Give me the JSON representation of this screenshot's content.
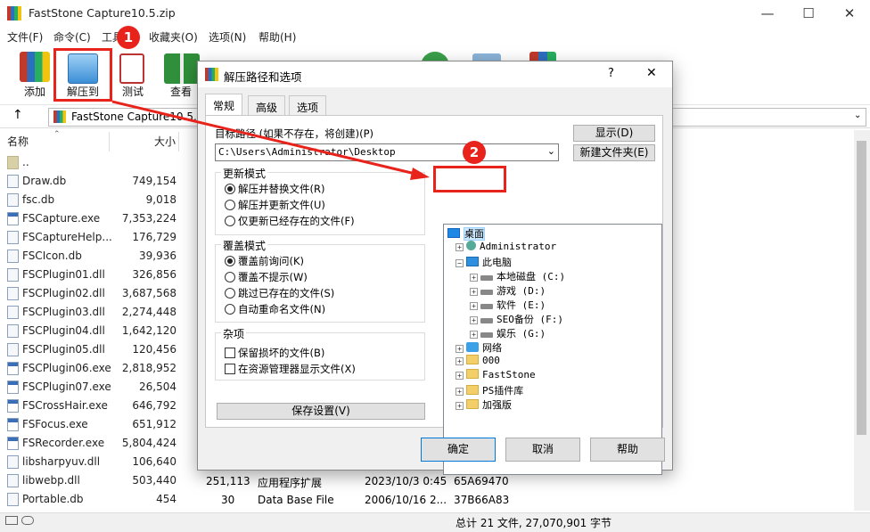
{
  "window": {
    "title": "FastStone Capture10.5.zip",
    "minimize": "—",
    "maximize": "☐",
    "close": "✕"
  },
  "menu": [
    "文件(F)",
    "命令(C)",
    "工具",
    "收藏夹(O)",
    "选项(N)",
    "帮助(H)"
  ],
  "toolbar": [
    {
      "label": "添加",
      "icon": "add-archive-icon"
    },
    {
      "label": "解压到",
      "icon": "extract-to-icon"
    },
    {
      "label": "测试",
      "icon": "test-icon"
    },
    {
      "label": "查看",
      "icon": "view-book-icon"
    }
  ],
  "address": {
    "up": "↑",
    "path": "FastStone Capture10.5.zi"
  },
  "list": {
    "headers": {
      "name": "名称",
      "size": "大小"
    },
    "rows": [
      {
        "name": "..",
        "size": "",
        "type": "folder"
      },
      {
        "name": "Draw.db",
        "size": "749,154",
        "type": "file"
      },
      {
        "name": "fsc.db",
        "size": "9,018",
        "type": "file"
      },
      {
        "name": "FSCapture.exe",
        "size": "7,353,224",
        "type": "exe"
      },
      {
        "name": "FSCaptureHelp...",
        "size": "176,729",
        "type": "help"
      },
      {
        "name": "FSCIcon.db",
        "size": "39,936",
        "type": "file"
      },
      {
        "name": "FSCPlugin01.dll",
        "size": "326,856",
        "type": "file"
      },
      {
        "name": "FSCPlugin02.dll",
        "size": "3,687,568",
        "type": "file"
      },
      {
        "name": "FSCPlugin03.dll",
        "size": "2,274,448",
        "type": "file"
      },
      {
        "name": "FSCPlugin04.dll",
        "size": "1,642,120",
        "type": "file"
      },
      {
        "name": "FSCPlugin05.dll",
        "size": "120,456",
        "type": "file"
      },
      {
        "name": "FSCPlugin06.exe",
        "size": "2,818,952",
        "type": "exe"
      },
      {
        "name": "FSCPlugin07.exe",
        "size": "26,504",
        "type": "exe"
      },
      {
        "name": "FSCrossHair.exe",
        "size": "646,792",
        "type": "exe"
      },
      {
        "name": "FSFocus.exe",
        "size": "651,912",
        "type": "exe"
      },
      {
        "name": "FSRecorder.exe",
        "size": "5,804,424",
        "type": "exe"
      },
      {
        "name": "libsharpyuv.dll",
        "size": "106,640",
        "type": "file"
      },
      {
        "name": "libwebp.dll",
        "size": "503,440",
        "type": "file"
      },
      {
        "name": "Portable.db",
        "size": "454",
        "type": "file"
      }
    ],
    "extra_rows": [
      {
        "packed": "251,113",
        "type": "应用程序扩展",
        "modified": "2023/10/3 0:45",
        "crc": "65A69470"
      },
      {
        "packed": "30",
        "type": "Data Base File",
        "modified": "2006/10/16 2...",
        "crc": "37B66A83"
      }
    ]
  },
  "status": {
    "text": "总计 21 文件, 27,070,901 字节"
  },
  "dialog": {
    "title": "解压路径和选项",
    "help": "?",
    "close": "✕",
    "tabs": [
      "常规",
      "高级",
      "选项"
    ],
    "dest_label": "目标路径 (如果不存在，将创建)(P)",
    "dest_value": "C:\\Users\\Administrator\\Desktop",
    "show_button": "显示(D)",
    "new_folder_button": "新建文件夹(E)",
    "update_mode": {
      "title": "更新模式",
      "options": [
        "解压并替换文件(R)",
        "解压并更新文件(U)",
        "仅更新已经存在的文件(F)"
      ],
      "selected": 0
    },
    "overwrite_mode": {
      "title": "覆盖模式",
      "options": [
        "覆盖前询问(K)",
        "覆盖不提示(W)",
        "跳过已存在的文件(S)",
        "自动重命名文件(N)"
      ],
      "selected": 0
    },
    "misc": {
      "title": "杂项",
      "options": [
        "保留损坏的文件(B)",
        "在资源管理器显示文件(X)"
      ]
    },
    "save_button": "保存设置(V)",
    "tree": [
      {
        "label": "桌面",
        "icon": "desk",
        "level": 0,
        "exp": ""
      },
      {
        "label": "Administrator",
        "icon": "user",
        "level": 1,
        "exp": "+"
      },
      {
        "label": "此电脑",
        "icon": "pc",
        "level": 1,
        "exp": "−"
      },
      {
        "label": "本地磁盘 (C:)",
        "icon": "drive",
        "level": 2,
        "exp": "+"
      },
      {
        "label": "游戏 (D:)",
        "icon": "drive",
        "level": 2,
        "exp": "+"
      },
      {
        "label": "软件 (E:)",
        "icon": "drive",
        "level": 2,
        "exp": "+"
      },
      {
        "label": "SEO备份 (F:)",
        "icon": "drive",
        "level": 2,
        "exp": "+"
      },
      {
        "label": "娱乐 (G:)",
        "icon": "drive",
        "level": 2,
        "exp": "+"
      },
      {
        "label": "网络",
        "icon": "net",
        "level": 1,
        "exp": "+"
      },
      {
        "label": "000",
        "icon": "folder",
        "level": 1,
        "exp": "+"
      },
      {
        "label": "FastStone",
        "icon": "folder",
        "level": 1,
        "exp": "+"
      },
      {
        "label": "PS插件库",
        "icon": "folder",
        "level": 1,
        "exp": "+"
      },
      {
        "label": "加强版",
        "icon": "folder",
        "level": 1,
        "exp": "+"
      }
    ],
    "ok": "确定",
    "cancel": "取消",
    "help_button": "帮助"
  },
  "annotations": {
    "step1": "1",
    "step2": "2",
    "color": "#e8231b"
  }
}
